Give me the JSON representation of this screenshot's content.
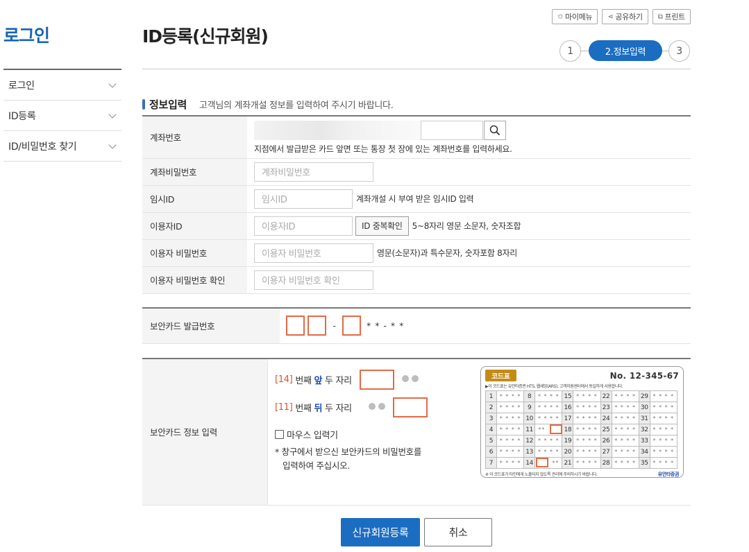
{
  "sidebar": {
    "title": "로그인",
    "items": [
      {
        "label": "로그인"
      },
      {
        "label": "ID등록"
      },
      {
        "label": "ID/비밀번호 찾기"
      }
    ]
  },
  "header": {
    "title": "ID등록(신규회원)",
    "util": {
      "mymenu": "마이메뉴",
      "share": "공유하기",
      "print": "프린트"
    },
    "steps": {
      "step1": "1",
      "step2": "2.정보입력",
      "step3": "3"
    }
  },
  "section": {
    "title": "정보입력",
    "desc": "고객님의 계좌개설 정보를 입력하여 주시기 바랍니다."
  },
  "form": {
    "account_label": "계좌번호",
    "account_hint": "지점에서 발급받은 카드 앞면 또는 통장 첫 장에 있는 계좌번호를 입력하세요.",
    "acct_pw_label": "계좌비밀번호",
    "acct_pw_placeholder": "계좌비밀번호",
    "temp_id_label": "임시ID",
    "temp_id_placeholder": "임시ID",
    "temp_id_hint": "계좌개설 시 부여 받은 임시ID 입력",
    "user_id_label": "이용자ID",
    "user_id_placeholder": "이용자ID",
    "dup_check": "ID 중복확인",
    "user_id_hint": "5~8자리 영문 소문자, 숫자조합",
    "user_pw_label": "이용자 비밀번호",
    "user_pw_placeholder": "이용자 비밀번호",
    "user_pw_hint": "영문(소문자)과 특수문자, 숫자포함 8자리",
    "user_pw2_label": "이용자 비밀번호 확인",
    "user_pw2_placeholder": "이용자 비밀번호 확인"
  },
  "security": {
    "card_no_label": "보안카드 발급번호",
    "dash": "-",
    "masked_tail": "* * - * *",
    "info_label": "보안카드 정보 입력",
    "q1_num": "[14]",
    "q1_pre": " 번째 ",
    "q1_em": "앞",
    "q1_post": " 두 자리",
    "q2_num": "[11]",
    "q2_pre": " 번째 ",
    "q2_em": "뒤",
    "q2_post": " 두 자리",
    "mouse_input": "마우스 입력기",
    "notice_line1": "* 창구에서 받으신 보안카드의 비밀번호를",
    "notice_line2": "입력하여 주십시오."
  },
  "code_card": {
    "tag": "코드표",
    "no": "No. 12-345-67",
    "note": "▶이 코드표는 유안타증권 HTS, 웹세밍(ARS), 고객지원센터에서 동일하게 사용합니다.",
    "foot": "※ 이 코드표가 타인에게 노출되지 않도록 관리에 주의하시기 바랍니다.",
    "logo": "유안타증권",
    "mask": "* * * *",
    "numbers": [
      [
        1,
        8,
        15,
        22,
        29
      ],
      [
        2,
        9,
        16,
        23,
        30
      ],
      [
        3,
        10,
        17,
        24,
        31
      ],
      [
        4,
        11,
        18,
        25,
        32
      ],
      [
        5,
        12,
        19,
        26,
        33
      ],
      [
        6,
        13,
        20,
        27,
        34
      ],
      [
        7,
        14,
        21,
        28,
        35
      ]
    ]
  },
  "actions": {
    "submit": "신규회원등록",
    "cancel": "취소"
  },
  "colors": {
    "brand_blue": "#1b6dc1",
    "highlight_orange": "#e26a45",
    "card_tag": "#c48a18"
  }
}
